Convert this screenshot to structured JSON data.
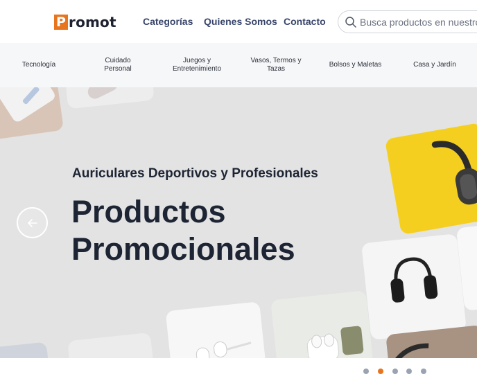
{
  "brand": {
    "logo_letter": "P",
    "logo_text": "romot",
    "accent_color": "#e8741e"
  },
  "nav": {
    "links": [
      "Categorías",
      "Quienes Somos",
      "Contacto"
    ]
  },
  "search": {
    "placeholder": "Busca productos en nuestro catálogo",
    "icon": "search-icon"
  },
  "categories": [
    "Tecnología",
    "Cuidado Personal",
    "Juegos y Entretenimiento",
    "Vasos, Termos y Tazas",
    "Bolsos y Maletas",
    "Casa y Jardín"
  ],
  "hero": {
    "subtitle": "Auriculares Deportivos y Profesionales",
    "title_line1": "Productos",
    "title_line2": "Promocionales",
    "prev_icon": "arrow-left-icon",
    "background": "#e3e3e3"
  },
  "carousel": {
    "total_slides": 5,
    "active_index": 1
  }
}
